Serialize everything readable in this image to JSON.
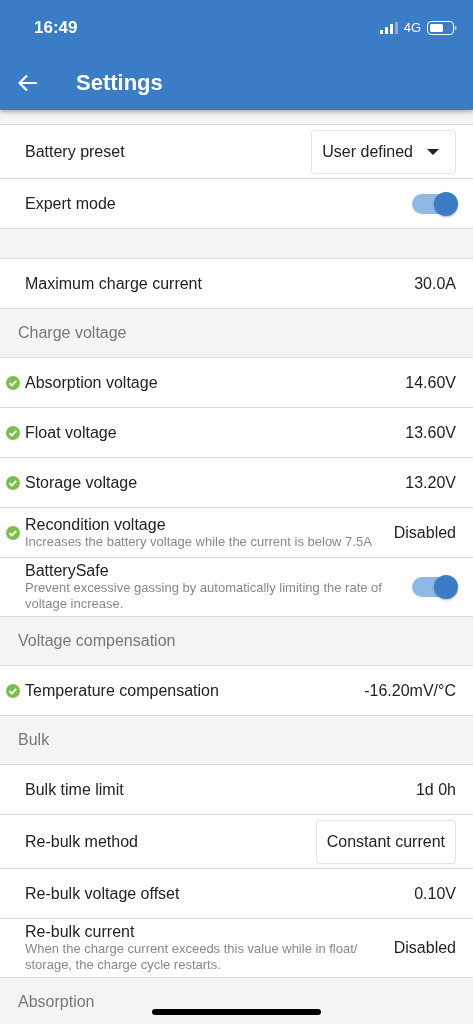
{
  "status_bar": {
    "time": "16:49",
    "network": "4G"
  },
  "app_bar": {
    "title": "Settings"
  },
  "blocks": [
    {
      "rows": [
        {
          "kind": "dropdown",
          "label": "Battery preset",
          "value": "User defined"
        },
        {
          "kind": "toggle",
          "label": "Expert mode",
          "on": true
        }
      ]
    },
    {
      "rows": [
        {
          "kind": "value",
          "label": "Maximum charge current",
          "value": "30.0A",
          "verified": false
        }
      ]
    },
    {
      "title": "Charge voltage",
      "rows": [
        {
          "kind": "value",
          "label": "Absorption voltage",
          "value": "14.60V",
          "verified": true
        },
        {
          "kind": "value",
          "label": "Float voltage",
          "value": "13.60V",
          "verified": true
        },
        {
          "kind": "value",
          "label": "Storage voltage",
          "value": "13.20V",
          "verified": true
        },
        {
          "kind": "value",
          "label": "Recondition voltage",
          "description": "Increases the battery voltage while the current is below 7.5A",
          "value": "Disabled",
          "verified": true
        },
        {
          "kind": "toggle",
          "label": "BatterySafe",
          "description": "Prevent excessive gassing by automatically limiting the rate of voltage increase.",
          "on": true
        }
      ]
    },
    {
      "title": "Voltage compensation",
      "rows": [
        {
          "kind": "value",
          "label": "Temperature compensation",
          "value": "-16.20mV/°C",
          "verified": true
        }
      ]
    },
    {
      "title": "Bulk",
      "rows": [
        {
          "kind": "value",
          "label": "Bulk time limit",
          "value": "1d 0h",
          "verified": false
        },
        {
          "kind": "button",
          "label": "Re-bulk method",
          "value": "Constant current"
        },
        {
          "kind": "value",
          "label": "Re-bulk voltage offset",
          "value": "0.10V",
          "verified": false
        },
        {
          "kind": "value",
          "label": "Re-bulk current",
          "description": "When the charge current exceeds this value while in float/ storage, the charge cycle restarts.",
          "value": "Disabled",
          "verified": false
        }
      ]
    },
    {
      "title": "Absorption"
    }
  ]
}
